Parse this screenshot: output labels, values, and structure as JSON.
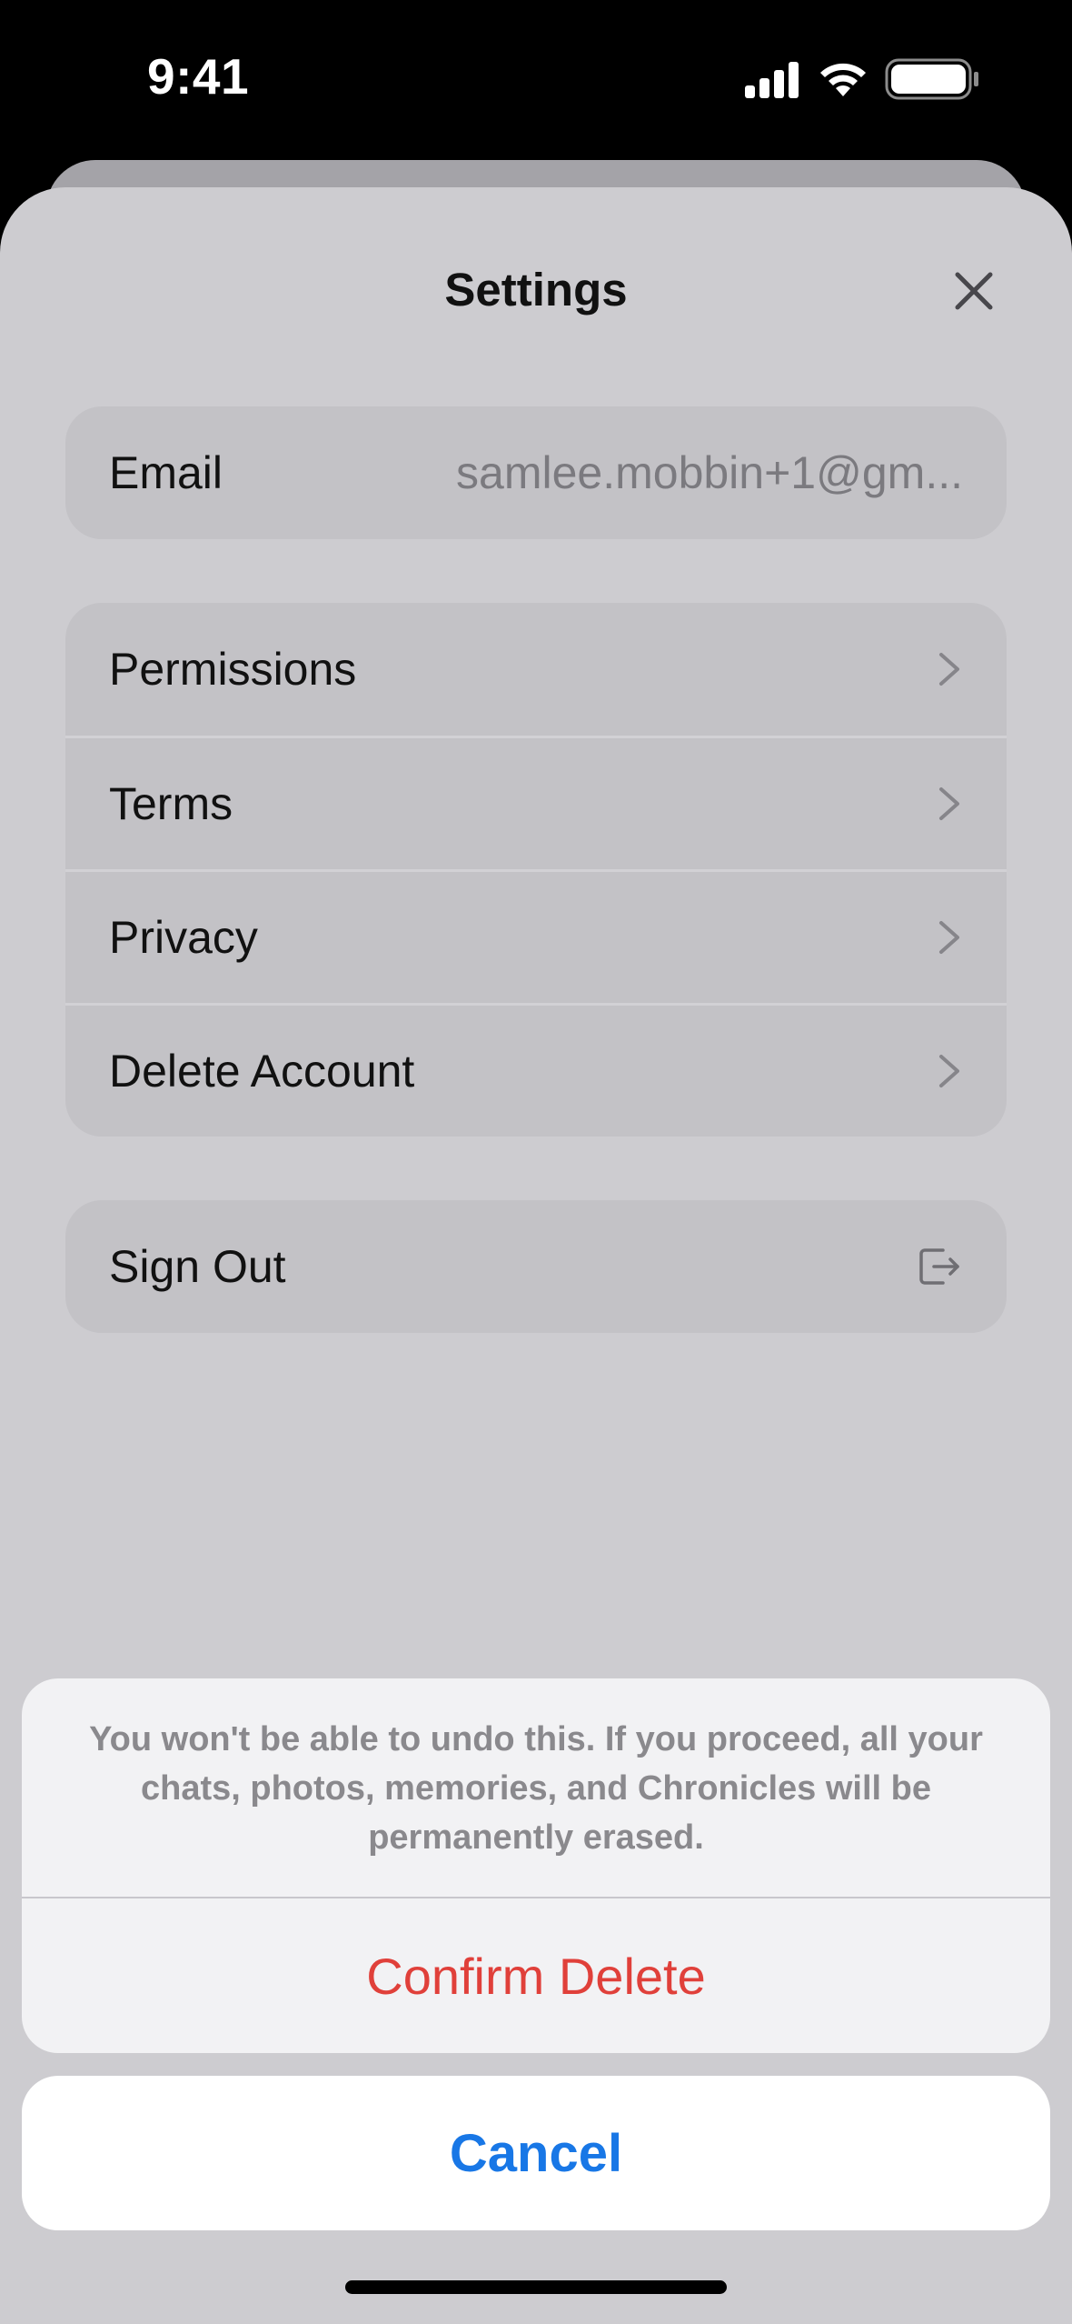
{
  "status_bar": {
    "time": "9:41",
    "icons": [
      "signal-icon",
      "wifi-icon",
      "battery-icon"
    ]
  },
  "sheet": {
    "title": "Settings",
    "close_icon": "close-icon"
  },
  "account": {
    "email_label": "Email",
    "email_value": "samlee.mobbin+1@gm..."
  },
  "menu": {
    "items": [
      {
        "label": "Permissions",
        "icon": "chevron-right-icon"
      },
      {
        "label": "Terms",
        "icon": "chevron-right-icon"
      },
      {
        "label": "Privacy",
        "icon": "chevron-right-icon"
      },
      {
        "label": "Delete Account",
        "icon": "chevron-right-icon"
      }
    ]
  },
  "sign_out": {
    "label": "Sign Out",
    "icon": "sign-out-icon"
  },
  "action_sheet": {
    "message": "You won't be able to undo this. If you proceed, all your chats, photos, memories, and Chronicles will be permanently erased.",
    "confirm_label": "Confirm Delete",
    "cancel_label": "Cancel"
  },
  "colors": {
    "destructive": "#e0403a",
    "accent": "#1877e6",
    "dimmed_background": "#cdccd0"
  }
}
